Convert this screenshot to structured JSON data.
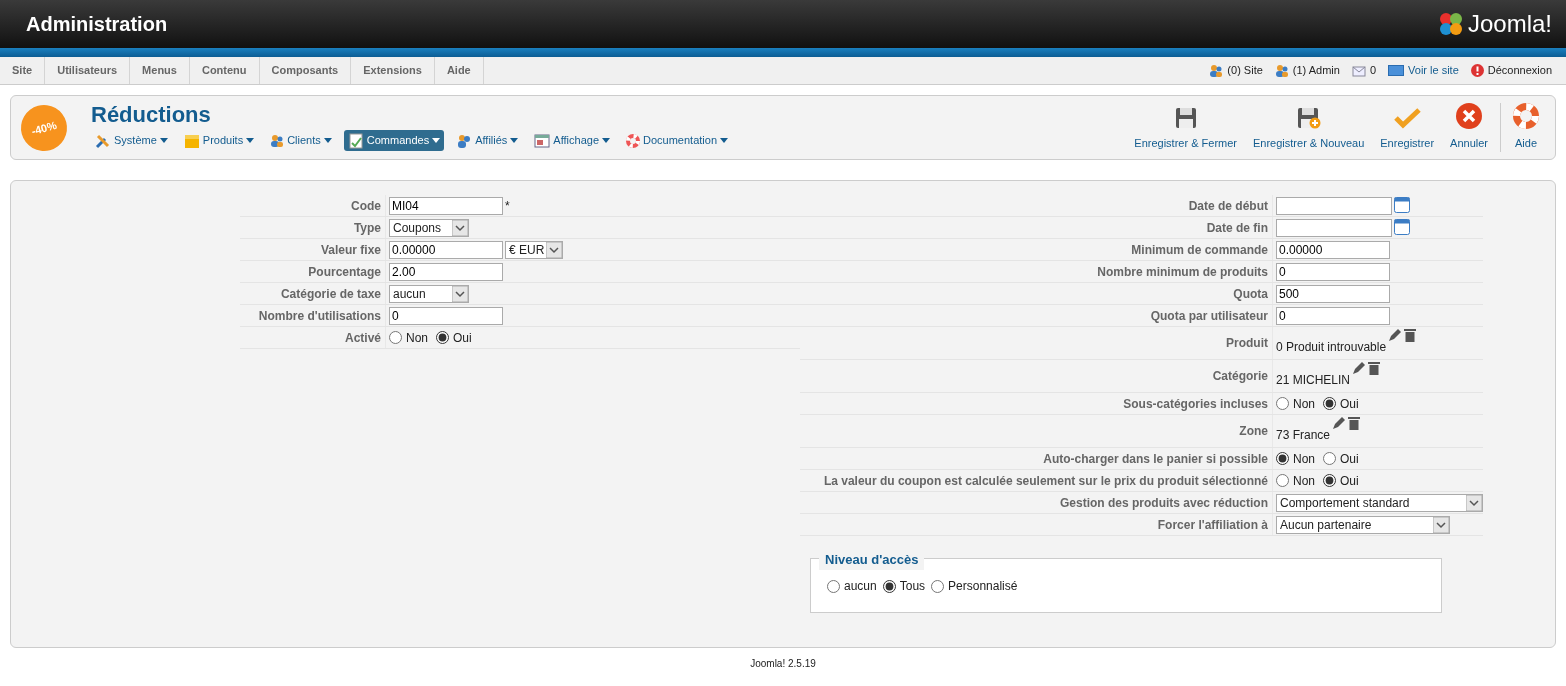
{
  "header": {
    "title": "Administration",
    "logo_text": "Joomla!"
  },
  "menu": [
    {
      "label": "Site"
    },
    {
      "label": "Utilisateurs"
    },
    {
      "label": "Menus"
    },
    {
      "label": "Contenu"
    },
    {
      "label": "Composants"
    },
    {
      "label": "Extensions"
    },
    {
      "label": "Aide"
    }
  ],
  "status": [
    {
      "kind": "users",
      "label": "(0) Site"
    },
    {
      "kind": "users",
      "label": "(1) Admin"
    },
    {
      "kind": "mail",
      "label": "0"
    },
    {
      "kind": "view",
      "label": "Voir le site"
    },
    {
      "kind": "logout",
      "label": "Déconnexion"
    }
  ],
  "component": {
    "badge": "-40%",
    "title": "Réductions",
    "submenu": [
      {
        "kind": "tools",
        "label": "Système",
        "selected": false
      },
      {
        "kind": "box",
        "label": "Produits",
        "selected": false
      },
      {
        "kind": "users",
        "label": "Clients",
        "selected": false
      },
      {
        "kind": "orders",
        "label": "Commandes",
        "selected": true
      },
      {
        "kind": "affiliates",
        "label": "Affiliés",
        "selected": false
      },
      {
        "kind": "display",
        "label": "Affichage",
        "selected": false
      },
      {
        "kind": "help",
        "label": "Documentation",
        "selected": false
      }
    ],
    "toolbar": [
      {
        "kind": "save-close",
        "label": "Enregistrer & Fermer"
      },
      {
        "kind": "save-new",
        "label": "Enregistrer & Nouveau"
      },
      {
        "kind": "apply",
        "label": "Enregistrer"
      },
      {
        "kind": "cancel",
        "label": "Annuler"
      },
      {
        "kind": "help",
        "label": "Aide"
      }
    ]
  },
  "form_left": [
    {
      "kind": "text",
      "label": "Code",
      "value": "MI04",
      "required_mark": "*"
    },
    {
      "kind": "select",
      "label": "Type",
      "value": "Coupons"
    },
    {
      "kind": "text_select",
      "label": "Valeur fixe",
      "value": "0.00000",
      "unit": "€ EUR"
    },
    {
      "kind": "text",
      "label": "Pourcentage",
      "value": "2.00"
    },
    {
      "kind": "select",
      "label": "Catégorie de taxe",
      "value": "aucun"
    },
    {
      "kind": "text",
      "label": "Nombre d'utilisations",
      "value": "0"
    },
    {
      "kind": "radio",
      "label": "Activé",
      "options": [
        {
          "label": "Non",
          "selected": false
        },
        {
          "label": "Oui",
          "selected": true
        }
      ]
    }
  ],
  "form_right": [
    {
      "kind": "date",
      "label": "Date de début"
    },
    {
      "kind": "date",
      "label": "Date de fin"
    },
    {
      "kind": "text",
      "label": "Minimum de commande",
      "value": "0.00000"
    },
    {
      "kind": "text",
      "label": "Nombre minimum de produits",
      "value": "0"
    },
    {
      "kind": "text",
      "label": "Quota",
      "value": "500"
    },
    {
      "kind": "text",
      "label": "Quota par utilisateur",
      "value": "0"
    },
    {
      "kind": "item",
      "label": "Produit",
      "value": "0 Produit introuvable"
    },
    {
      "kind": "item",
      "label": "Catégorie",
      "value": "21 MICHELIN"
    },
    {
      "kind": "radio",
      "label": "Sous-catégories incluses",
      "options": [
        {
          "label": "Non",
          "selected": false
        },
        {
          "label": "Oui",
          "selected": true
        }
      ]
    },
    {
      "kind": "item",
      "label": "Zone",
      "value": "73 France"
    },
    {
      "kind": "radio",
      "label": "Auto-charger dans le panier si possible",
      "options": [
        {
          "label": "Non",
          "selected": true
        },
        {
          "label": "Oui",
          "selected": false
        }
      ]
    },
    {
      "kind": "radio",
      "label": "La valeur du coupon est calculée seulement sur le prix du produit sélectionné",
      "options": [
        {
          "label": "Non",
          "selected": false
        },
        {
          "label": "Oui",
          "selected": true
        }
      ]
    },
    {
      "kind": "select",
      "label": "Gestion des produits avec réduction",
      "value": "Comportement standard"
    },
    {
      "kind": "select",
      "label": "Forcer l'affiliation à",
      "value": "Aucun partenaire"
    }
  ],
  "access": {
    "legend": "Niveau d'accès",
    "options": [
      {
        "label": "aucun",
        "selected": false
      },
      {
        "label": "Tous",
        "selected": true
      },
      {
        "label": "Personnalisé",
        "selected": false
      }
    ]
  },
  "footer": "Joomla! 2.5.19"
}
